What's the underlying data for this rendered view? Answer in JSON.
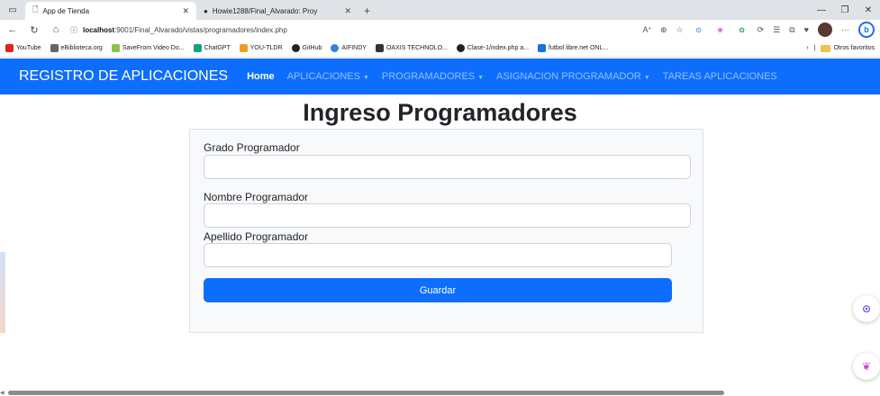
{
  "browser": {
    "tabs": [
      {
        "title": "App de Tienda",
        "active": true
      },
      {
        "title": "Howie1288/Final_Alvarado: Proy",
        "active": false
      }
    ],
    "url_host": "localhost",
    "url_rest": ":9001/Final_Alvarado/vistas/programadores/index.php",
    "bookmarks": [
      "YouTube",
      "eBiblioteca.org",
      "SaveFrom Video Do...",
      "ChatGPT",
      "YOU-TLDR",
      "GitHub",
      "AIFINDY",
      "OAXIS TECHNOLO...",
      "Clase-1/index.php a...",
      "futbol libre.net ONL..."
    ],
    "other_bookmarks": "Otros favoritos"
  },
  "navbar": {
    "brand": "REGISTRO DE APLICACIONES",
    "links": [
      {
        "label": "Home",
        "active": true
      },
      {
        "label": "APLICACIONES",
        "dropdown": true
      },
      {
        "label": "PROGRAMADORES",
        "dropdown": true
      },
      {
        "label": "ASIGNACION PROGRAMADOR",
        "dropdown": true
      },
      {
        "label": "TAREAS APLICACIONES",
        "dropdown": false
      }
    ]
  },
  "page": {
    "title": "Ingreso Programadores"
  },
  "form": {
    "grado_label": "Grado Programador",
    "grado_value": "",
    "nombre_label": "Nombre Programador",
    "nombre_value": "",
    "apellido_label": "Apellido Programador",
    "apellido_value": "",
    "submit_label": "Guardar"
  },
  "colors": {
    "primary": "#0d6efd",
    "card_bg": "#f8f9fa"
  }
}
